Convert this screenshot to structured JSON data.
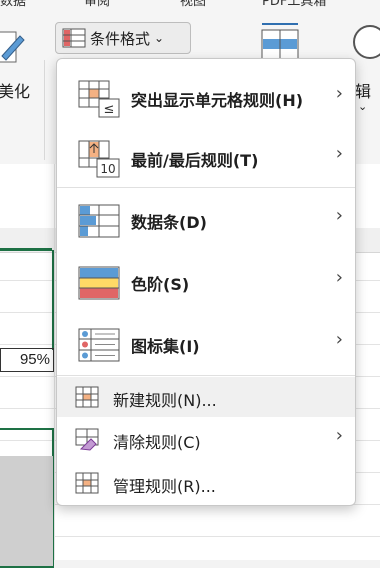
{
  "ribbon": {
    "tabs_partial": [
      "数据",
      "审阅",
      "视图",
      "PDF工具箱"
    ],
    "conditional_format_label": "条件格式",
    "left_label": "美化",
    "right_label": "辑"
  },
  "sheet": {
    "cell_value": "95%"
  },
  "menu": {
    "items": [
      {
        "label": "突出显示单元格规则(H)",
        "icon": "highlight-cells-icon",
        "submenu": true
      },
      {
        "label": "最前/最后规则(T)",
        "icon": "top-bottom-icon",
        "submenu": true
      },
      {
        "label": "数据条(D)",
        "icon": "data-bars-icon",
        "submenu": true
      },
      {
        "label": "色阶(S)",
        "icon": "color-scales-icon",
        "submenu": true
      },
      {
        "label": "图标集(I)",
        "icon": "icon-sets-icon",
        "submenu": true
      }
    ],
    "secondary": [
      {
        "label": "新建规则(N)...",
        "icon": "new-rule-icon",
        "submenu": false
      },
      {
        "label": "清除规则(C)",
        "icon": "clear-rules-icon",
        "submenu": true
      },
      {
        "label": "管理规则(R)...",
        "icon": "manage-rules-icon",
        "submenu": false
      }
    ]
  },
  "colors": {
    "accent_green": "#1e7145",
    "orange": "#f4b183",
    "red": "#e06666",
    "blue": "#5b9bd5",
    "yellow": "#ffd966"
  }
}
